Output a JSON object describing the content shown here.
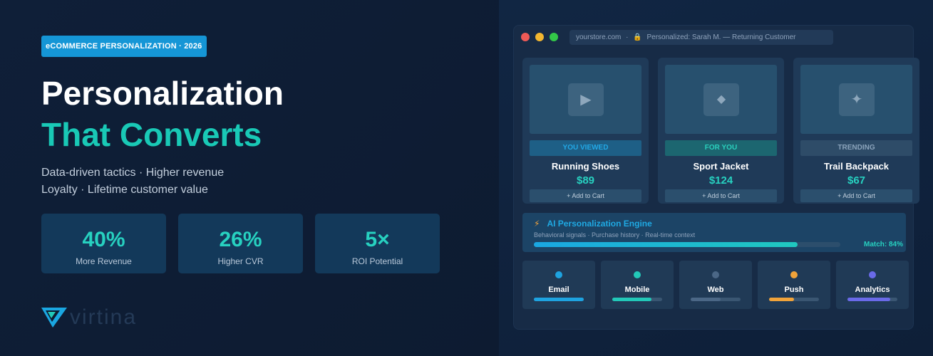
{
  "hero": {
    "tag": "eCOMMERCE PERSONALIZATION · 2026",
    "title_line1": "Personalization",
    "title_line2": "That Converts",
    "subtitle_line1": "Data-driven tactics · Higher revenue",
    "subtitle_line2": "Loyalty · Lifetime customer value"
  },
  "stats": [
    {
      "value": "40%",
      "label": "More Revenue"
    },
    {
      "value": "26%",
      "label": "Higher CVR"
    },
    {
      "value": "5×",
      "label": "ROI Potential"
    }
  ],
  "brand": {
    "name": "virtina"
  },
  "browser": {
    "url": "yourstore.com",
    "separator": "·",
    "session": "Personalized: Sarah M. — Returning Customer"
  },
  "products": [
    {
      "badge": "YOU VIEWED",
      "name": "Running Shoes",
      "price": "$89",
      "cta": "+ Add to Cart",
      "icon": "play-icon",
      "badge_bg": "#1e5f86",
      "badge_color": "#22a8e6"
    },
    {
      "badge": "FOR YOU",
      "name": "Sport Jacket",
      "price": "$124",
      "cta": "+ Add to Cart",
      "icon": "diamond-icon",
      "badge_bg": "#1c6670",
      "badge_color": "#2ad0bd"
    },
    {
      "badge": "TRENDING",
      "name": "Trail Backpack",
      "price": "$67",
      "cta": "+ Add to Cart",
      "icon": "sparkle-icon",
      "badge_bg": "#2e4c68",
      "badge_color": "#8ba4bc"
    }
  ],
  "engine": {
    "title": "AI Personalization Engine",
    "subtitle": "Behavioral signals · Purchase history · Real-time context",
    "match_label": "Match: 84%",
    "match": 0.86
  },
  "channels": [
    {
      "label": "Email",
      "color": "#1ea3e0",
      "level": 1.0
    },
    {
      "label": "Mobile",
      "color": "#22c8b8",
      "level": 0.78
    },
    {
      "label": "Web",
      "color": "#4b6786",
      "level": 0.6
    },
    {
      "label": "Push",
      "color": "#f0a33a",
      "level": 0.5
    },
    {
      "label": "Analytics",
      "color": "#6a6ae8",
      "level": 0.85
    }
  ]
}
